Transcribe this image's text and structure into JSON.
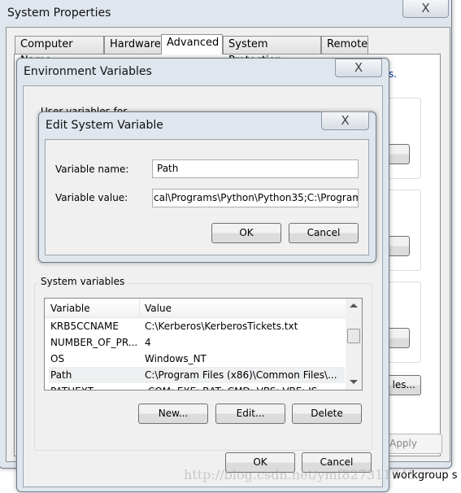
{
  "system_properties": {
    "title": "System Properties",
    "tabs": [
      "Computer Name",
      "Hardware",
      "Advanced",
      "System Protection",
      "Remote"
    ],
    "active_tab": "Advanced",
    "apply_label": "Apply",
    "partial_right": [
      "s.",
      "les...",
      "d workgroup s"
    ]
  },
  "env_vars": {
    "title": "Environment Variables",
    "user_vars_label": "User variables for ...",
    "system_vars_label": "System variables",
    "columns": [
      "Variable",
      "Value"
    ],
    "rows": [
      {
        "variable": "KRB5CCNAME",
        "value": "C:\\Kerberos\\KerberosTickets.txt"
      },
      {
        "variable": "NUMBER_OF_PR...",
        "value": "4"
      },
      {
        "variable": "OS",
        "value": "Windows_NT"
      },
      {
        "variable": "Path",
        "value": "C:\\Program Files (x86)\\Common Files\\..."
      },
      {
        "variable": "PATHEXT",
        "value": ".COM;.EXE;.BAT;.CMD;.VBS;.VBE;.JS"
      }
    ],
    "selected_row": "Path",
    "new_label": "New...",
    "edit_label": "Edit...",
    "delete_label": "Delete",
    "ok_label": "OK",
    "cancel_label": "Cancel"
  },
  "edit_var": {
    "title": "Edit System Variable",
    "name_label": "Variable name:",
    "name_value": "Path",
    "value_label": "Variable value:",
    "value_value": "cal\\Programs\\Python\\Python35;C:\\Program",
    "ok_label": "OK",
    "cancel_label": "Cancel"
  },
  "watermark": "http://blog.csdn.net/ymf827311945",
  "close_glyph": "X"
}
